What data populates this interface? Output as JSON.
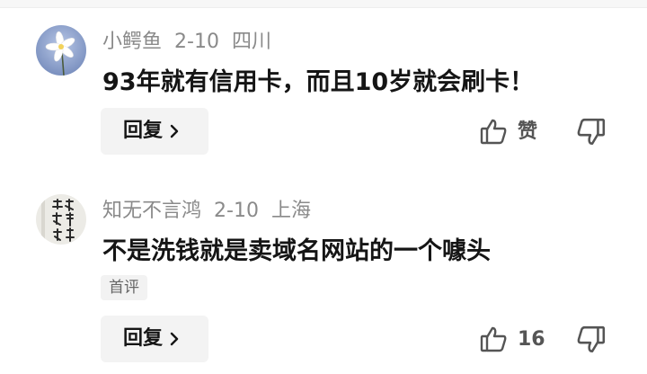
{
  "comments": [
    {
      "username": "小鳄鱼",
      "date": "2-10",
      "location": "四川",
      "text": "93年就有信用卡，而且10岁就会刷卡！",
      "badge": "",
      "reply_label": "回复",
      "like_label": "赞",
      "avatar_icon": "white-flower-avatar"
    },
    {
      "username": "知无不言鸿",
      "date": "2-10",
      "location": "上海",
      "text": "不是洗钱就是卖域名网站的一个噱头",
      "badge": "首评",
      "reply_label": "回复",
      "like_label": "16",
      "avatar_icon": "calligraphy-avatar"
    }
  ],
  "icons": {
    "reply_chevron": "chevron-right-icon",
    "like": "thumbs-up-icon",
    "dislike": "thumbs-down-icon"
  },
  "colors": {
    "meta_text": "#8a8a8a",
    "button_bg": "#f3f3f3",
    "icon_stroke": "#555555"
  }
}
